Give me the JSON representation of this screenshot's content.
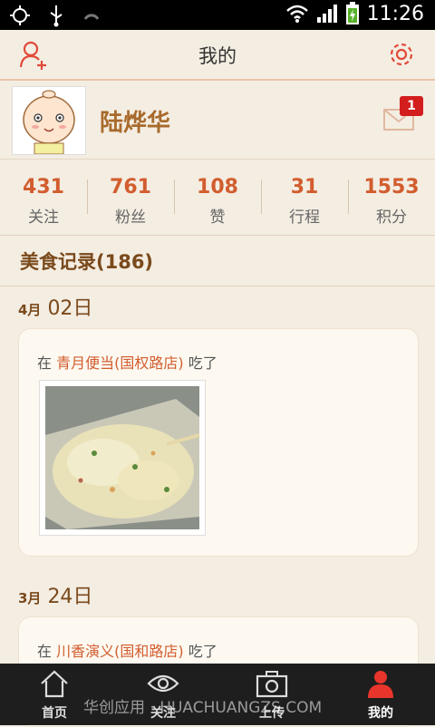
{
  "status": {
    "time": "11:26"
  },
  "header": {
    "title": "我的"
  },
  "profile": {
    "username": "陆烨华",
    "unread": "1"
  },
  "stats": [
    {
      "value": "431",
      "label": "关注"
    },
    {
      "value": "761",
      "label": "粉丝"
    },
    {
      "value": "108",
      "label": "赞"
    },
    {
      "value": "31",
      "label": "行程"
    },
    {
      "value": "1553",
      "label": "积分"
    }
  ],
  "records_title": "美食记录(186)",
  "entries": [
    {
      "month": "4月",
      "day": "02日",
      "prefix": "在",
      "place": "青月便当(国权路店)",
      "suffix": "吃了"
    },
    {
      "month": "3月",
      "day": "24日",
      "prefix": "在",
      "place": "川香演义(国和路店)",
      "suffix": "吃了"
    }
  ],
  "tabs": [
    {
      "label": "首页",
      "icon": "home-icon"
    },
    {
      "label": "关注",
      "icon": "eye-icon"
    },
    {
      "label": "上传",
      "icon": "camera-icon"
    },
    {
      "label": "我的",
      "icon": "person-icon"
    }
  ],
  "watermark": "华创应用 · HUACHUANGZS.COM",
  "colors": {
    "accent": "#d25d2e",
    "brand_brown": "#a86a2c",
    "active_tab": "#e8352b"
  }
}
